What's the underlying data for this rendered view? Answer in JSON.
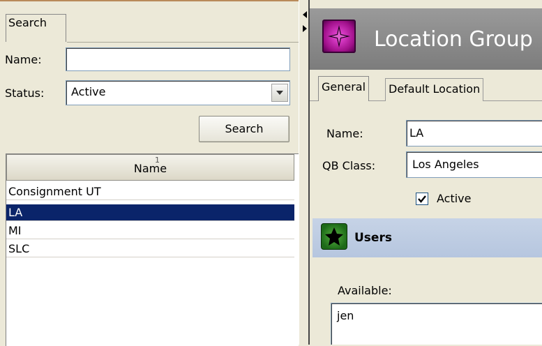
{
  "left": {
    "tab_label": "Search",
    "name_label": "Name:",
    "name_value": "",
    "status_label": "Status:",
    "status_value": "Active",
    "search_button": "Search",
    "grid_header": "Name",
    "sort_indicator": "1",
    "rows": [
      {
        "name": "Consignment UT",
        "selected": false
      },
      {
        "name": "LA",
        "selected": true
      },
      {
        "name": "MI",
        "selected": false
      },
      {
        "name": "SLC",
        "selected": false
      }
    ]
  },
  "right": {
    "title": "Location Group",
    "logo_icon": "location-group-icon",
    "tabs": [
      "General",
      "Default Location"
    ],
    "name_label": "Name:",
    "name_value": "LA",
    "qb_class_label": "QB Class:",
    "qb_class_value": "Los Angeles",
    "active_label": "Active",
    "active_checked": true,
    "users_section": "Users",
    "users_icon": "users-icon",
    "available_label": "Available:",
    "available_items": [
      "jen"
    ]
  },
  "colors": {
    "selection": "#0a246a",
    "header_bg": "#8c8c8c",
    "users_band": "#c0cfe4",
    "window_bg": "#ece9d8",
    "logo": "#c020b0"
  }
}
